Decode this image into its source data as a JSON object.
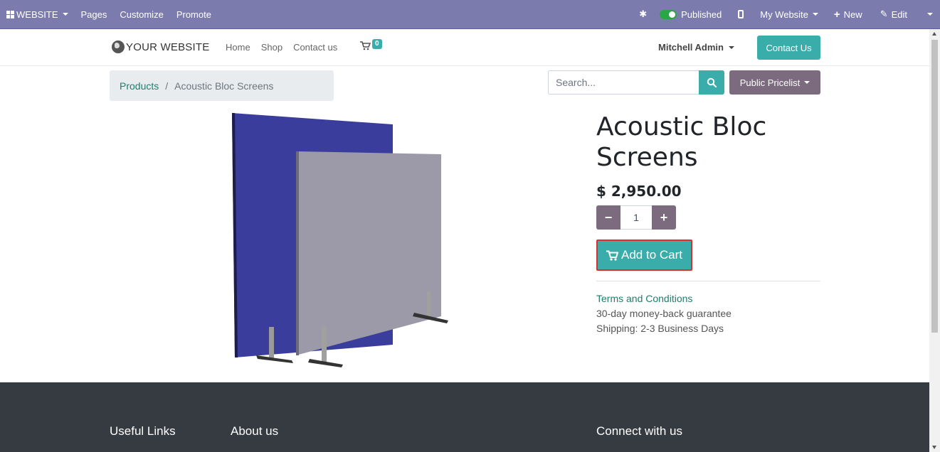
{
  "adminbar": {
    "website_label": "WEBSITE",
    "pages_label": "Pages",
    "customize_label": "Customize",
    "promote_label": "Promote",
    "published_label": "Published",
    "my_website_label": "My Website",
    "new_label": "New",
    "edit_label": "Edit"
  },
  "header": {
    "logo_text": "YOUR WEBSITE",
    "nav": [
      "Home",
      "Shop",
      "Contact us"
    ],
    "cart_count": "0",
    "user_name": "Mitchell Admin",
    "contact_button": "Contact Us"
  },
  "breadcrumb": {
    "parent": "Products",
    "separator": "/",
    "current": "Acoustic Bloc Screens"
  },
  "search": {
    "placeholder": "Search..."
  },
  "pricelist": {
    "label": "Public Pricelist"
  },
  "product": {
    "name": "Acoustic Bloc Screens",
    "price": "$ 2,950.00",
    "quantity": "1",
    "add_to_cart": "Add to Cart",
    "terms": "Terms and Conditions",
    "guarantee": "30-day money-back guarantee",
    "shipping": "Shipping: 2-3 Business Days"
  },
  "footer": {
    "useful_links": "Useful Links",
    "about_us": "About us",
    "connect": "Connect with us"
  },
  "colors": {
    "admin_bar": "#7c7bad",
    "accent": "#3aadaa",
    "secondary": "#7c6a7e",
    "footer": "#363a41"
  }
}
